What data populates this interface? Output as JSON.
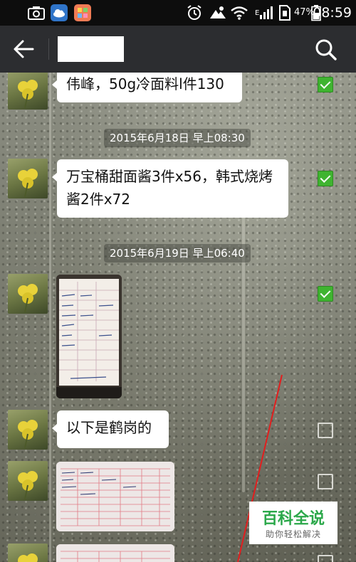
{
  "status_bar": {
    "battery_percent": "47%",
    "time": "08:59",
    "network_label": "E",
    "icons": [
      "camera-icon",
      "cloud-icon",
      "app-icon",
      "alarm-icon",
      "weather-icon",
      "wifi-icon",
      "signal-icon",
      "sim-icon",
      "battery-icon"
    ]
  },
  "action_bar": {
    "title": "",
    "icons": [
      "back-arrow-icon",
      "search-icon"
    ]
  },
  "messages": [
    {
      "type": "text",
      "text": "伟峰，50g冷面料l件130",
      "selected": true
    },
    {
      "type": "timestamp",
      "text": "2015年6月18日 早上08:30"
    },
    {
      "type": "text",
      "text": "万宝桶甜面酱3件x56，韩式烧烤酱2件x72",
      "selected": true
    },
    {
      "type": "timestamp",
      "text": "2015年6月19日 早上06:40"
    },
    {
      "type": "image",
      "description": "handwritten order form",
      "selected": true
    },
    {
      "type": "text",
      "text": "以下是鹤岗的",
      "selected": false
    },
    {
      "type": "image",
      "description": "red grid order form",
      "selected": false
    },
    {
      "type": "image",
      "description": "red grid order form",
      "selected": false
    }
  ],
  "watermark": {
    "title": "百科全说",
    "subtitle": "助你轻松解决"
  },
  "colors": {
    "status_bar": "#0d0d0d",
    "action_bar": "#2c2d30",
    "checkbox_on": "#3fb430",
    "watermark_green": "#2ba84a",
    "annotation_red": "#e21e1e"
  }
}
